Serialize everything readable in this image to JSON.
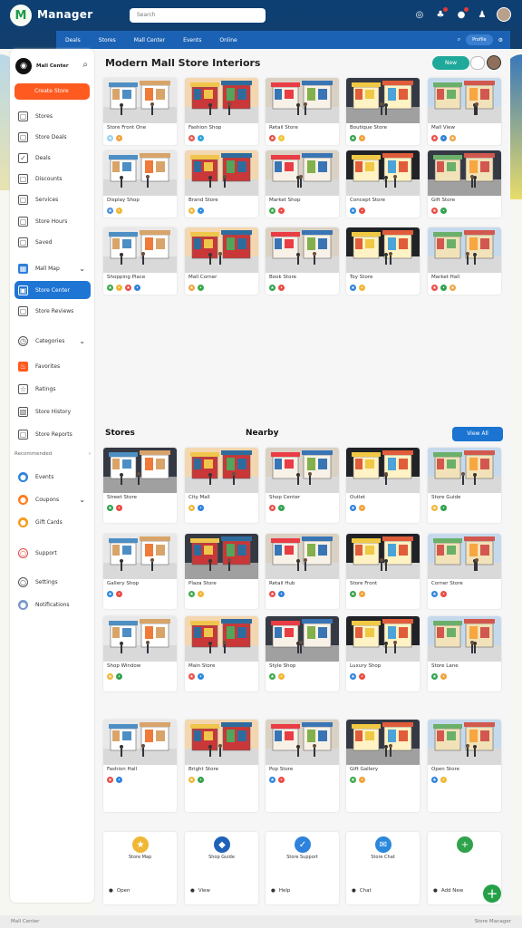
{
  "app": {
    "brand": "Manager",
    "brand_mark": "M",
    "search_placeholder": "Search"
  },
  "header": {
    "tabs": [
      "Deals",
      "Stores",
      "Mall Center",
      "Events",
      "Online"
    ],
    "icons": [
      "search-icon",
      "person-icon",
      "settings-icon"
    ]
  },
  "sidebar": {
    "brand": "Mall Center",
    "cta": "Create Store",
    "items": [
      {
        "label": "Stores",
        "icon": "checkbox-icon"
      },
      {
        "label": "Store Deals",
        "icon": "checkbox-icon"
      },
      {
        "label": "Deals",
        "icon": "check-icon"
      },
      {
        "label": "Discounts",
        "icon": "checkbox-icon"
      },
      {
        "label": "Services",
        "icon": "checkbox-icon"
      },
      {
        "label": "Store Hours",
        "icon": "checkbox-icon"
      },
      {
        "label": "Saved",
        "icon": "checkbox-icon"
      },
      {
        "label": "Mall Map",
        "icon": "grid-icon"
      },
      {
        "label": "Store Center",
        "icon": "store-icon"
      },
      {
        "label": "Store Reviews",
        "icon": "checkbox-icon"
      },
      {
        "label": "Categories",
        "icon": "clock-icon"
      },
      {
        "label": "Favorites",
        "icon": "fire-icon"
      },
      {
        "label": "Ratings",
        "icon": "star-icon"
      },
      {
        "label": "Store History",
        "icon": "image-icon"
      },
      {
        "label": "Store Reports",
        "icon": "checkbox-icon"
      }
    ],
    "section": "Recommended",
    "bottom_items": [
      {
        "label": "Events",
        "icon": "calendar-icon"
      },
      {
        "label": "Coupons",
        "icon": "tag-icon"
      },
      {
        "label": "Gift Cards",
        "icon": "card-icon"
      },
      {
        "label": "Support",
        "icon": "help-icon"
      },
      {
        "label": "Settings",
        "icon": "gear-icon"
      },
      {
        "label": "Notifications",
        "icon": "bell-icon"
      }
    ]
  },
  "main": {
    "title": "Modern Mall Store Interiors",
    "new_button": "New",
    "section_a": "Stores",
    "section_b": "Nearby",
    "more_button": "View All",
    "cards": [
      {
        "caption": "Store Front One",
        "icons": [
          "#9bd0f2",
          "#f3a13b"
        ],
        "scene": "a"
      },
      {
        "caption": "Fashion Shop",
        "icons": [
          "#e8554d",
          "#2fa3dd"
        ],
        "scene": "b"
      },
      {
        "caption": "Retail Store",
        "icons": [
          "#e84b44",
          "#f1c53a"
        ],
        "scene": "c"
      },
      {
        "caption": "Boutique Store",
        "icons": [
          "#30a24c",
          "#f0a33c"
        ],
        "scene": "d"
      },
      {
        "caption": "Mall View",
        "icons": [
          "#ea4b44",
          "#2e82dc",
          "#f0a33c"
        ],
        "scene": "e"
      },
      {
        "caption": "Display Shop",
        "icons": [
          "#4d8fde",
          "#f0b736"
        ],
        "scene": "f"
      },
      {
        "caption": "Brand Store",
        "icons": [
          "#f0b736",
          "#2d8de1"
        ],
        "scene": "g"
      },
      {
        "caption": "Market Shop",
        "icons": [
          "#3aa94c",
          "#ea4b44"
        ],
        "scene": "h"
      },
      {
        "caption": "Concept Store",
        "icons": [
          "#2a88dd",
          "#ea4b44"
        ],
        "scene": "i"
      },
      {
        "caption": "Gift Store",
        "icons": [
          "#e94b45",
          "#30a24c"
        ],
        "scene": "j"
      },
      {
        "caption": "Shopping Place",
        "icons": [
          "#3aa94c",
          "#f0b736",
          "#ea4b44",
          "#2e82dc"
        ],
        "scene": "k"
      },
      {
        "caption": "Mall Corner",
        "icons": [
          "#f0a33c",
          "#3aa94c"
        ],
        "scene": "l"
      },
      {
        "caption": "Book Store",
        "icons": [
          "#30a24c",
          "#ea4b44"
        ],
        "scene": "m"
      },
      {
        "caption": "Toy Store",
        "icons": [
          "#2e82dc",
          "#f0b736"
        ],
        "scene": "n"
      },
      {
        "caption": "Market Hall",
        "icons": [
          "#e94b45",
          "#30a24c",
          "#f0a33c"
        ],
        "scene": "o"
      }
    ],
    "nearby": [
      {
        "caption": "Street Store",
        "icons": [
          "#30a24c",
          "#ea4b44"
        ],
        "scene": "p"
      },
      {
        "caption": "City Mall",
        "icons": [
          "#f0b736",
          "#2e82dc"
        ],
        "scene": "q"
      },
      {
        "caption": "Shop Center",
        "icons": [
          "#ea4b44",
          "#30a24c"
        ],
        "scene": "r"
      },
      {
        "caption": "Outlet",
        "icons": [
          "#2e82dc",
          "#f0a33c"
        ],
        "scene": "s"
      },
      {
        "caption": "Store Guide",
        "icons": [
          "#f0b736",
          "#30a24c"
        ],
        "scene": "t"
      },
      {
        "caption": "Gallery Shop",
        "icons": [
          "#2a88dd",
          "#ea4b44"
        ],
        "scene": "u"
      },
      {
        "caption": "Plaza Store",
        "icons": [
          "#3aa94c",
          "#f0b736"
        ],
        "scene": "v"
      },
      {
        "caption": "Retail Hub",
        "icons": [
          "#ea4b44",
          "#2e82dc"
        ],
        "scene": "w"
      },
      {
        "caption": "Store Front",
        "icons": [
          "#30a24c",
          "#f0a33c"
        ],
        "scene": "x"
      },
      {
        "caption": "Corner Store",
        "icons": [
          "#2e82dc",
          "#ea4b44"
        ],
        "scene": "y"
      },
      {
        "caption": "Shop Window",
        "icons": [
          "#f0b736",
          "#30a24c"
        ],
        "scene": "z"
      },
      {
        "caption": "Main Store",
        "icons": [
          "#ea4b44",
          "#2a88dd"
        ],
        "scene": "aa"
      },
      {
        "caption": "Style Shop",
        "icons": [
          "#3aa94c",
          "#f0b736"
        ],
        "scene": "ab"
      },
      {
        "caption": "Luxury Shop",
        "icons": [
          "#2e82dc",
          "#ea4b44"
        ],
        "scene": "ac"
      },
      {
        "caption": "Store Lane",
        "icons": [
          "#30a24c",
          "#f0a33c"
        ],
        "scene": "ad"
      },
      {
        "caption": "Fashion Hall",
        "icons": [
          "#ea4b44",
          "#2e82dc"
        ],
        "scene": "ae"
      },
      {
        "caption": "Bright Store",
        "icons": [
          "#f0b736",
          "#30a24c"
        ],
        "scene": "af"
      },
      {
        "caption": "Pop Store",
        "icons": [
          "#2a88dd",
          "#ea4b44"
        ],
        "scene": "ag"
      },
      {
        "caption": "Gift Gallery",
        "icons": [
          "#3aa94c",
          "#f0a33c"
        ],
        "scene": "ah"
      },
      {
        "caption": "Open Store",
        "icons": [
          "#2e82dc",
          "#f0b736"
        ],
        "scene": "ai"
      }
    ],
    "bottom_tiles": [
      {
        "title": "Store Map",
        "foot": "Open",
        "icon_color": "#f0b736",
        "icon": "★"
      },
      {
        "title": "Shop Guide",
        "foot": "View",
        "icon_color": "#1f62b8",
        "icon": "◆"
      },
      {
        "title": "Store Support",
        "foot": "Help",
        "icon_color": "#2e82dc",
        "icon": "✓"
      },
      {
        "title": "Store Chat",
        "foot": "Chat",
        "icon_color": "#2a88dd",
        "icon": "✉"
      },
      {
        "title": "",
        "foot": "Add New",
        "icon_color": "#30a24c",
        "icon": "+"
      }
    ],
    "fab": "+"
  },
  "footer": {
    "left": "Mall Center",
    "right": "Store Manager"
  }
}
